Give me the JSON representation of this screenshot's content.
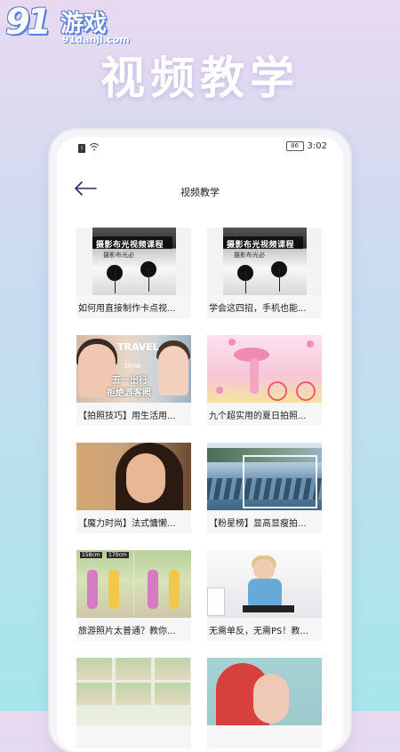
{
  "logo": {
    "number": "91",
    "name": "游戏",
    "url": "91danji.com"
  },
  "hero_title": "视频教学",
  "status_bar": {
    "time": "3:02",
    "battery": "86"
  },
  "app_bar": {
    "title": "视频教学"
  },
  "videos": [
    {
      "caption": "如何用直接制作卡点视...",
      "thumb_title": "摄影布光视频课程",
      "thumb_sub": "摄影布光必"
    },
    {
      "caption": "学会这四招，手机也能...",
      "thumb_title": "摄影布光视频课程",
      "thumb_sub": "摄影布光必"
    },
    {
      "caption": "【拍照技巧】用生活用...",
      "thumb_line1": "TRAVEL",
      "thumb_line2": "time",
      "thumb_line3": "五一出行",
      "thumb_line4": "拒绝游客照"
    },
    {
      "caption": "九个超实用的夏日拍照..."
    },
    {
      "caption": "【魔力时尚】法式慵懒..."
    },
    {
      "caption": "【粉星榜】显高显瘦拍..."
    },
    {
      "caption": "旅游照片太普通？教你...",
      "tag1": "158cm",
      "tag2": "170cm"
    },
    {
      "caption": "无需单反，无需PS！教..."
    },
    {
      "caption": ""
    },
    {
      "caption": ""
    }
  ]
}
